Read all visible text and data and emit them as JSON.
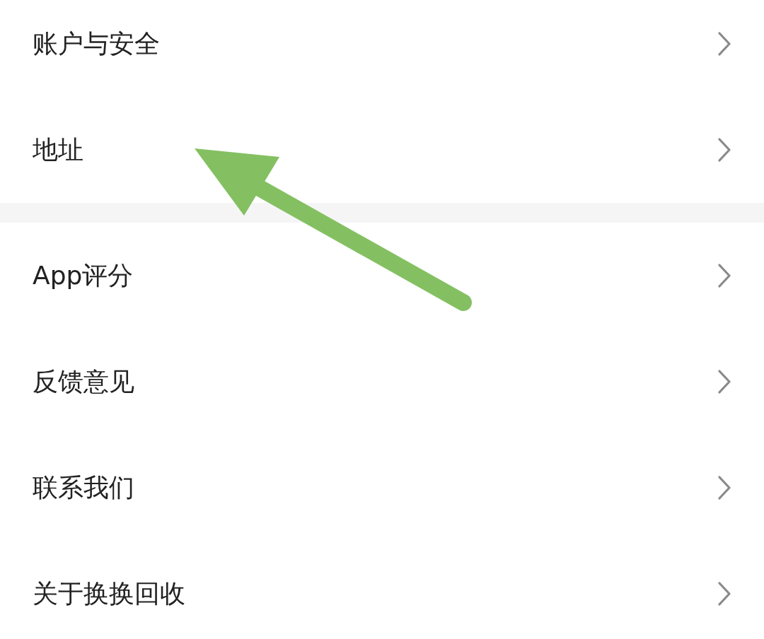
{
  "sections": [
    {
      "items": [
        {
          "label": "账户与安全"
        },
        {
          "label": "地址"
        }
      ]
    },
    {
      "items": [
        {
          "label": "App评分"
        },
        {
          "label": "反馈意见"
        },
        {
          "label": "联系我们"
        },
        {
          "label": "关于换换回收"
        }
      ]
    }
  ]
}
